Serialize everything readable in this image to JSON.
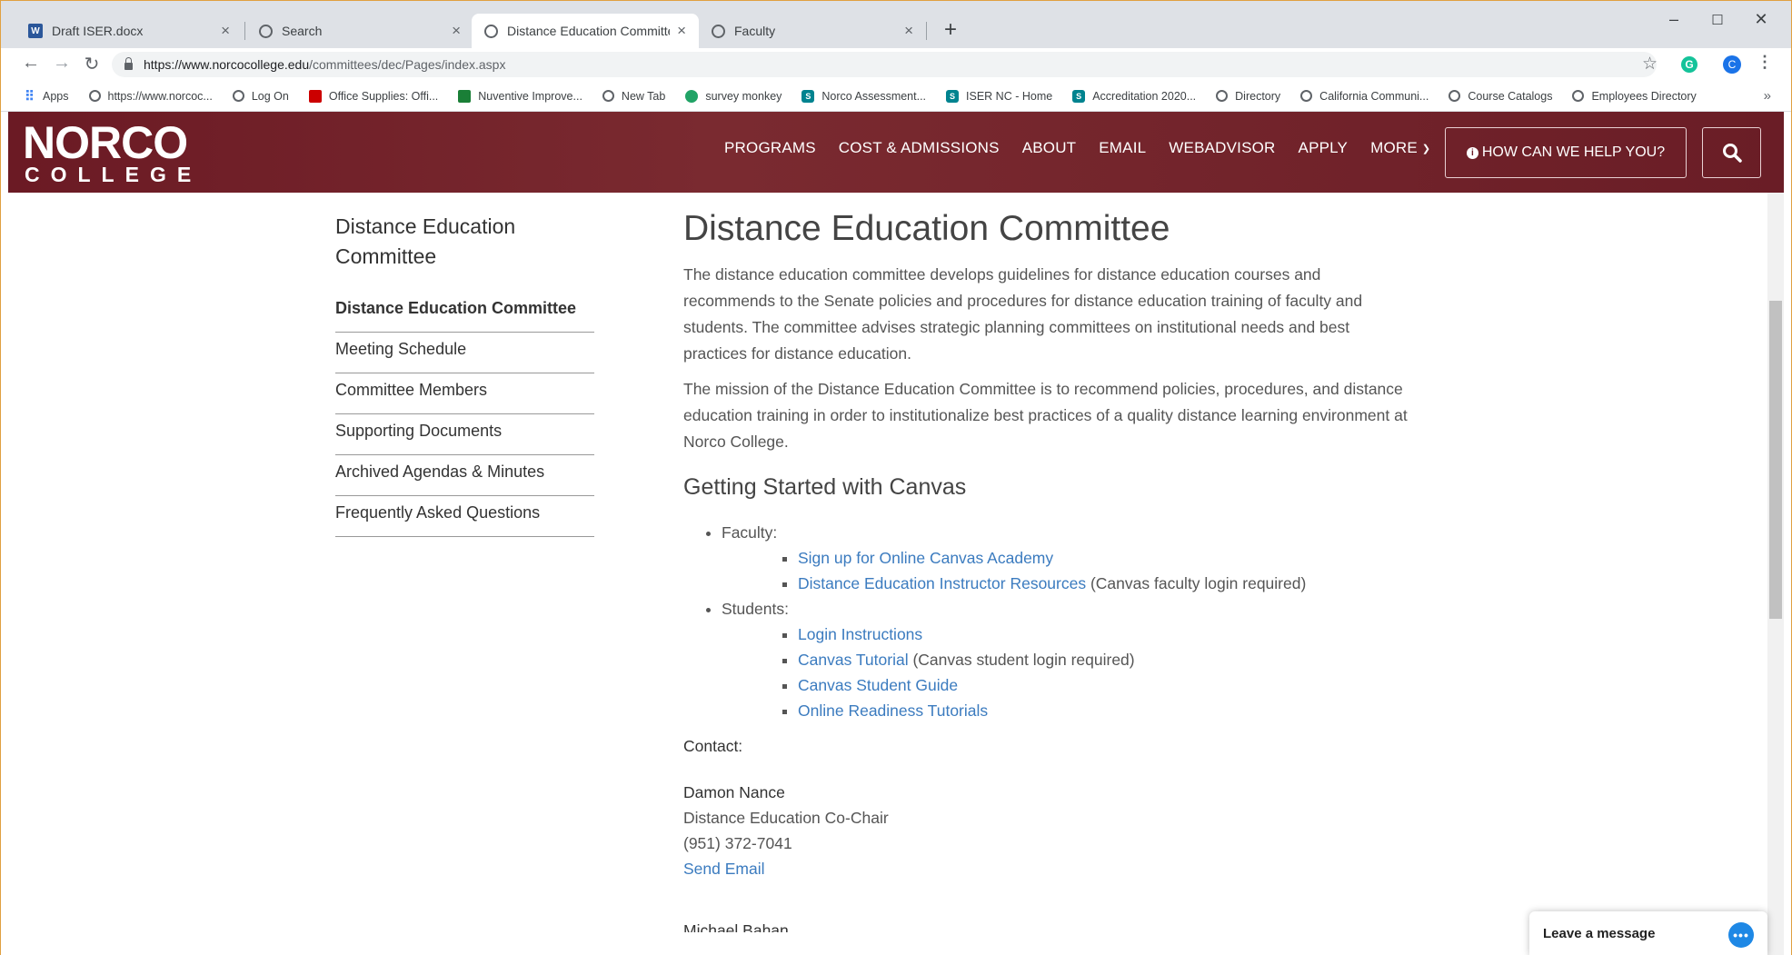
{
  "browser": {
    "tabs": [
      {
        "title": "Draft ISER.docx",
        "icon": "word-icon"
      },
      {
        "title": "Search",
        "icon": "globe-icon"
      },
      {
        "title": "Distance Education Committee",
        "icon": "globe-icon"
      },
      {
        "title": "Faculty",
        "icon": "globe-icon"
      }
    ],
    "active_tab_index": 2,
    "url_host": "https://www.norcocollege.edu",
    "url_path": "/committees/dec/Pages/index.aspx",
    "profile_initial": "C",
    "bookmarks": [
      {
        "label": "Apps",
        "icon": "apps-grid-icon"
      },
      {
        "label": "https://www.norcoc...",
        "icon": "globe-icon"
      },
      {
        "label": "Log On",
        "icon": "globe-icon"
      },
      {
        "label": "Office Supplies: Offi...",
        "icon": "office-depot-icon"
      },
      {
        "label": "Nuventive Improve...",
        "icon": "nuventive-icon"
      },
      {
        "label": "New Tab",
        "icon": "globe-icon"
      },
      {
        "label": "survey monkey",
        "icon": "surveymonkey-icon"
      },
      {
        "label": "Norco Assessment...",
        "icon": "sharepoint-icon"
      },
      {
        "label": "ISER NC - Home",
        "icon": "sharepoint-icon"
      },
      {
        "label": "Accreditation 2020...",
        "icon": "sharepoint-icon"
      },
      {
        "label": "Directory",
        "icon": "globe-icon"
      },
      {
        "label": "California Communi...",
        "icon": "globe-icon"
      },
      {
        "label": "Course Catalogs",
        "icon": "globe-icon"
      },
      {
        "label": "Employees Directory",
        "icon": "globe-icon"
      }
    ]
  },
  "site": {
    "logo_main": "NORCO",
    "logo_sub": "COLLEGE",
    "nav": [
      "PROGRAMS",
      "COST & ADMISSIONS",
      "ABOUT",
      "EMAIL",
      "WEBADVISOR",
      "APPLY",
      "MORE"
    ],
    "help_button": "HOW CAN WE HELP YOU?",
    "brand_color": "#6b1a24",
    "link_color": "#3b7bbf"
  },
  "sidebar": {
    "heading": "Distance Education Committee",
    "items": [
      "Distance Education Committee",
      "Meeting Schedule",
      "Committee Members",
      "Supporting Documents",
      "Archived Agendas & Minutes",
      "Frequently Asked Questions"
    ]
  },
  "main": {
    "title": "Distance Education Committee",
    "para1": "The distance education committee develops guidelines for distance education courses and recommends to the Senate policies and procedures for distance education training of faculty and students. The committee advises strategic planning committees on institutional needs and best practices for distance education.",
    "para2": "The mission of the Distance Education Committee is to recommend policies, procedures, and distance education training in order to institutionalize best practices of a quality distance learning environment at Norco College.",
    "subheading": "Getting Started with Canvas",
    "faculty_label": "Faculty:",
    "faculty_links": [
      {
        "link": "Sign up for Online Canvas Academy",
        "note": ""
      },
      {
        "link": "Distance Education Instructor Resources",
        "note": " (Canvas faculty login required)"
      }
    ],
    "students_label": "Students:",
    "student_links": [
      {
        "link": "Login Instructions",
        "note": ""
      },
      {
        "link": "Canvas Tutorial",
        "note": " (Canvas student login required)"
      },
      {
        "link": "Canvas Student Guide",
        "note": ""
      },
      {
        "link": "Online Readiness Tutorials",
        "note": ""
      }
    ],
    "contact_label": "Contact:",
    "contact": {
      "name": "Damon Nance",
      "role": "Distance Education Co-Chair",
      "phone": "(951) 372-7041",
      "email_link": "Send Email"
    },
    "next_contact_partial": "Michael Bahan"
  },
  "chat": {
    "label": "Leave a message"
  }
}
